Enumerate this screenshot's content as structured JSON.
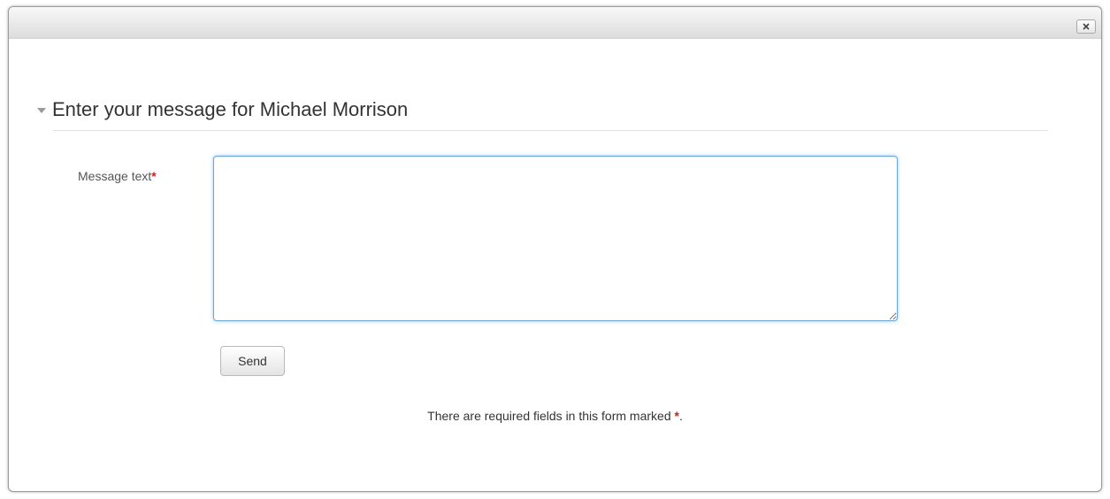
{
  "dialog": {
    "close_label": "×"
  },
  "form": {
    "legend": "Enter your message for Michael Morrison",
    "message_label": "Message text",
    "required_marker": "*",
    "message_value": "",
    "send_label": "Send",
    "required_note_prefix": "There are required fields in this form marked",
    "required_note_marker": "*",
    "required_note_suffix": "."
  },
  "colors": {
    "required": "#c8201c",
    "focus_border": "#6fa4d9",
    "text": "#333333"
  }
}
